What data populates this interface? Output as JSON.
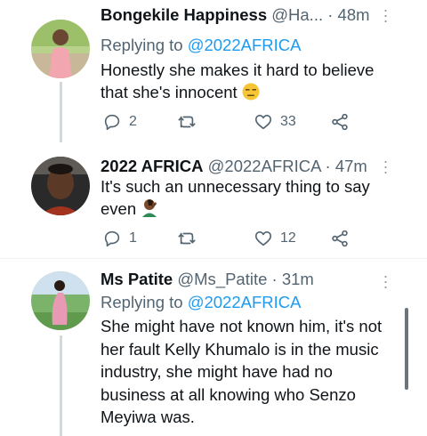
{
  "tweets": [
    {
      "name": "Bongekile Happiness",
      "handle_time": "@Ha... · 48m",
      "replying_prefix": "Replying to",
      "replying_handle": "@2022AFRICA",
      "text_line1": "Honestly she makes it hard to believe",
      "text_line2": "that she's innocent",
      "replies": "2",
      "likes": "33"
    },
    {
      "name": "2022 AFRICA",
      "handle_time": "@2022AFRICA · 47m",
      "text_line1": "It's such an unnecessary thing to say",
      "text_line2": "even",
      "replies": "1",
      "likes": "12"
    },
    {
      "name": "Ms Patite",
      "handle_time": "@Ms_Patite · 31m",
      "replying_prefix": "Replying to",
      "replying_handle": "@2022AFRICA",
      "text_lines": [
        "She might have not known him, it's not",
        "her fault Kelly Khumalo is in the music",
        "industry, she might have had no",
        "business at all knowing who Senzo",
        "Meyiwa was."
      ]
    }
  ],
  "icons": {
    "reply": "reply-icon",
    "retweet": "retweet-icon",
    "like": "heart-icon",
    "share": "share-icon",
    "more": "more-icon"
  },
  "colors": {
    "link": "#1d9bf0",
    "secondary": "#536471",
    "thread_line": "#cfd9de"
  }
}
